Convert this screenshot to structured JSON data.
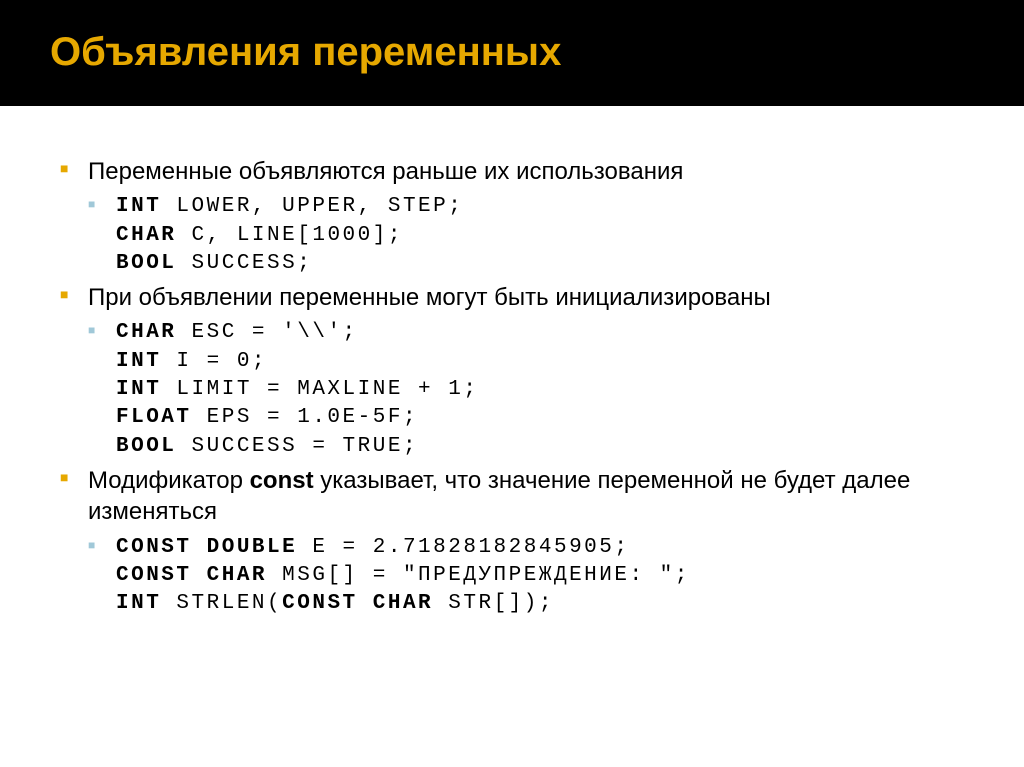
{
  "title": "Объявления переменных",
  "bullets": [
    {
      "text": "Переменные объявляются раньше их использования",
      "code": [
        {
          "kw": "int",
          "rest": " lower, upper, step;"
        },
        {
          "kw": "char",
          "rest": " c, line[1000];"
        },
        {
          "kw": "bool",
          "rest": " success;"
        }
      ]
    },
    {
      "text": "При объявлении переменные могут быть инициализированы",
      "code": [
        {
          "kw": "char",
          "rest": " esc = '\\\\';"
        },
        {
          "kw": "int",
          "rest": " i = 0;"
        },
        {
          "kw": "int",
          "rest": " limit = maxline + 1;"
        },
        {
          "kw": "float",
          "rest": " eps = 1.0e-5f;"
        },
        {
          "kw": "bool",
          "rest": " success = true;"
        }
      ]
    },
    {
      "text_pre": "Модификатор ",
      "text_bold": "const",
      "text_post": " указывает, что значение переменной не будет далее изменяться",
      "code": [
        {
          "kw": "const double",
          "rest": " e = 2.71828182845905;"
        },
        {
          "kw": "const char",
          "rest": " msg[] = \"предупреждение: \";"
        },
        {
          "kw": "int",
          "rest": " strlen(",
          "kw2": "const char",
          "rest2": " str[]);"
        }
      ]
    }
  ]
}
